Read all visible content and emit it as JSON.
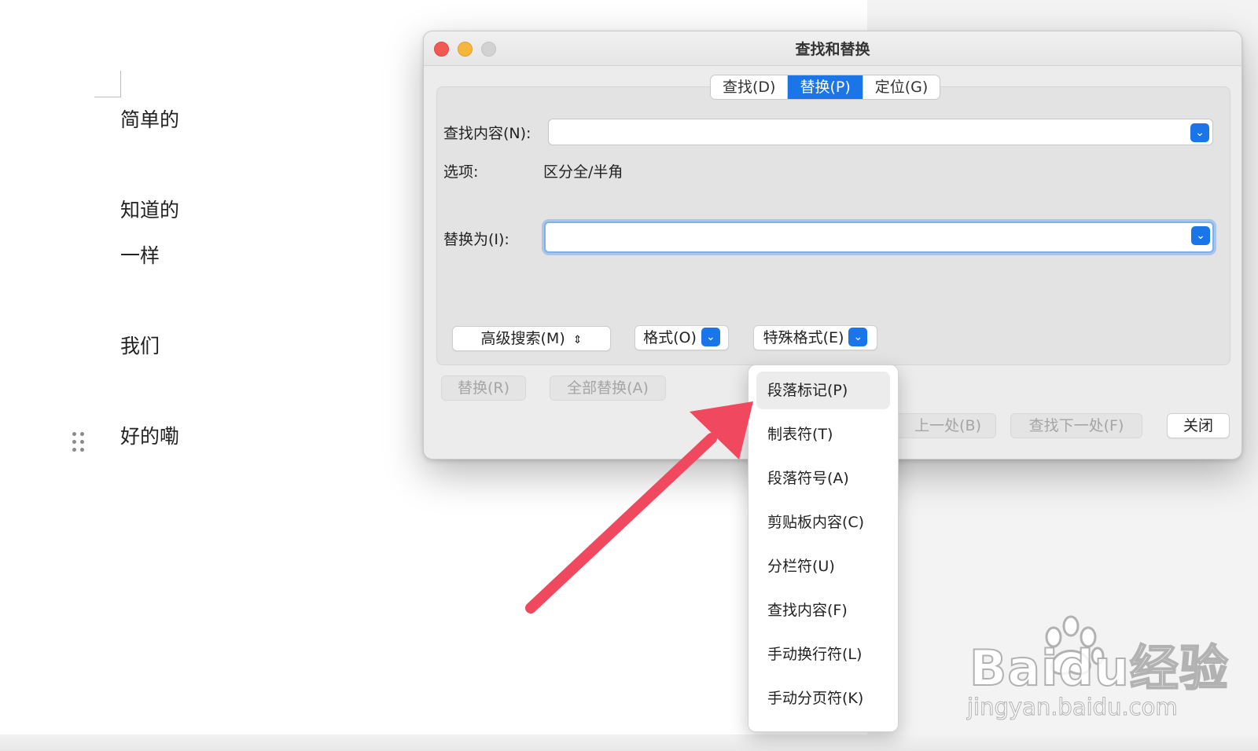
{
  "document": {
    "lines": [
      "简单的",
      "知道的",
      "一样",
      "我们",
      "好的嘞"
    ]
  },
  "dialog": {
    "title": "查找和替换",
    "tabs": [
      {
        "label": "查找(D)",
        "active": false
      },
      {
        "label": "替换(P)",
        "active": true
      },
      {
        "label": "定位(G)",
        "active": false
      }
    ],
    "find_label": "查找内容(N):",
    "find_value": "",
    "options_label": "选项:",
    "options_value": "区分全/半角",
    "replace_label": "替换为(I):",
    "replace_value": "",
    "advanced_search_label": "高级搜索(M)",
    "format_label": "格式(O)",
    "special_format_label": "特殊格式(E)",
    "replace_button": "替换(R)",
    "replace_all_button": "全部替换(A)",
    "find_prev_button": "上一处(B)",
    "find_next_button": "查找下一处(F)",
    "close_button": "关闭"
  },
  "special_menu": {
    "items": [
      "段落标记(P)",
      "制表符(T)",
      "段落符号(A)",
      "剪贴板内容(C)",
      "分栏符(U)",
      "查找内容(F)",
      "手动换行符(L)",
      "手动分页符(K)"
    ],
    "highlighted_index": 0
  },
  "watermark": {
    "logo_text": "Baidu经验",
    "url": "jingyan.baidu.com"
  },
  "colors": {
    "accent": "#1a76e8",
    "annotation_arrow": "#f0485e",
    "close_dot": "#f15a52",
    "minimize_dot": "#f6b53b",
    "zoom_dot": "#d2d2d2"
  }
}
